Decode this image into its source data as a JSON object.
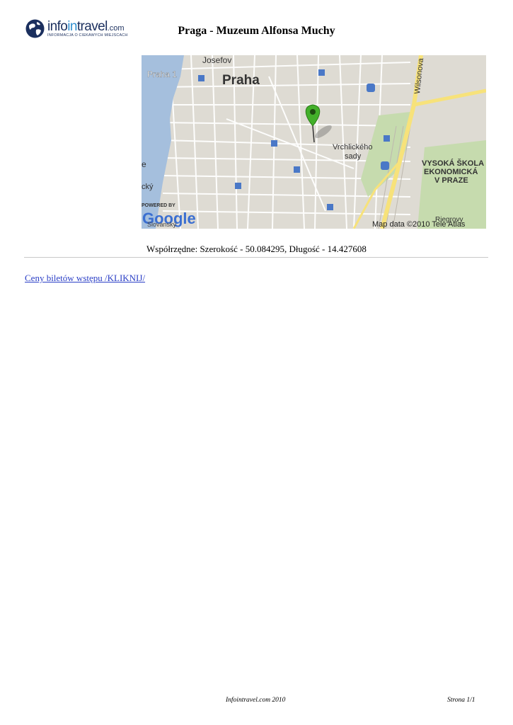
{
  "header": {
    "logo_brand_left": "info",
    "logo_brand_mid": "in",
    "logo_brand_right": "travel",
    "logo_brand_suffix": ".com",
    "logo_tagline": "INFORMACJA O CIEKAWYCH MIEJSCACH",
    "title": "Praga - Muzeum Alfonsa Muchy"
  },
  "map": {
    "labels": {
      "josefov": "Josefov",
      "praha1": "Praha 1",
      "praha": "Praha",
      "wilsonova": "Wilsonova",
      "vrchlickeho": "Vrchlického",
      "sady": "sady",
      "vse1": "VYSOKÁ ŠKOLA",
      "vse2": "EKONOMICKÁ",
      "vse3": "V PRAZE",
      "cut_e": "e",
      "cut_cky": "cký",
      "powered": "POWERED BY",
      "google": "Google",
      "credit": "Map data ©2010 Tele Atlas",
      "bottom_left": "Slovanský",
      "bottom_right": "Riegrovy"
    },
    "colors": {
      "water": "#a5bfdd",
      "street": "#ffffff",
      "block": "#dedbd3",
      "park": "#c6dbae",
      "highway": "#f7e27a",
      "marker": "#43b02a",
      "metro": "#4a78c7"
    }
  },
  "coordinates_text": "Współrzędne: Szerokość - 50.084295, Długość - 14.427608",
  "ticket_link": "Ceny biletów wstępu /KLIKNIJ/",
  "footer": {
    "site": "Infointravel.com 2010",
    "page": "Strona 1/1"
  }
}
